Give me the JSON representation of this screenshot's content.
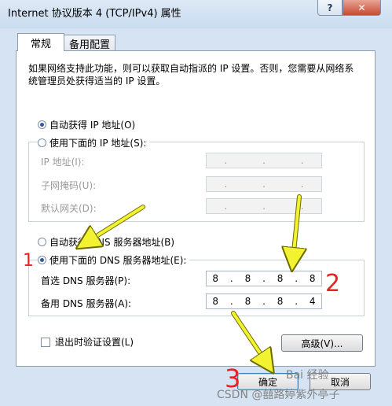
{
  "window": {
    "title": "Internet 协议版本 4 (TCP/IPv4) 属性",
    "help_label": "?",
    "close_label": "✕"
  },
  "tabs": [
    {
      "label": "常规",
      "active": true
    },
    {
      "label": "备用配置",
      "active": false
    }
  ],
  "description": "如果网络支持此功能，则可以获取自动指派的 IP 设置。否则，您需要从网络系统管理员处获得适当的 IP 设置。",
  "ip_section": {
    "auto_label": "自动获得 IP 地址(O)",
    "auto_selected": true,
    "manual_label": "使用下面的 IP 地址(S):",
    "manual_selected": false,
    "fields": [
      {
        "label": "IP 地址(I):",
        "value": [
          ".",
          ".",
          "."
        ]
      },
      {
        "label": "子网掩码(U):",
        "value": [
          ".",
          ".",
          "."
        ]
      },
      {
        "label": "默认网关(D):",
        "value": [
          ".",
          ".",
          "."
        ]
      }
    ]
  },
  "dns_section": {
    "auto_label": "自动获得 DNS 服务器地址(B)",
    "auto_selected": false,
    "manual_label": "使用下面的 DNS 服务器地址(E):",
    "manual_selected": true,
    "preferred": {
      "label": "首选 DNS 服务器(P):",
      "octets": [
        "8",
        "8",
        "8",
        "8"
      ]
    },
    "alternate": {
      "label": "备用 DNS 服务器(A):",
      "octets": [
        "8",
        "8",
        "8",
        "4"
      ]
    }
  },
  "validate_label": "退出时验证设置(L)",
  "validate_checked": false,
  "advanced_label": "高级(V)...",
  "ok_label": "确定",
  "cancel_label": "取消",
  "annotations": {
    "step1": "1",
    "step2": "2",
    "step3": "3",
    "arrow_color": "#f2f230",
    "mark_color": "#e8231f"
  },
  "watermark": "CSDN @囍路婷紫外亭子",
  "watermark2": "Bai 经验"
}
